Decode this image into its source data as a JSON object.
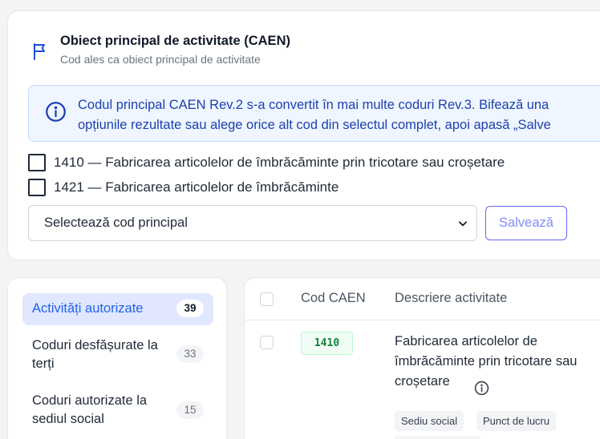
{
  "section": {
    "title": "Obiect principal de activitate (CAEN)",
    "subtitle": "Cod ales ca obiect principal de activitate",
    "icon": "flag-icon"
  },
  "alert": {
    "icon": "info-icon",
    "line1": "Codul principal CAEN Rev.2 s-a convertit în mai multe coduri Rev.3. Bifează una",
    "line2": "opțiunile rezultate sau alege orice alt cod din selectul complet, apoi apasă „Salve"
  },
  "options": [
    {
      "label": "1410 — Fabricarea articolelor de îmbrăcăminte prin tricotare sau croșetare",
      "checked": false
    },
    {
      "label": "1421 — Fabricarea articolelor de îmbrăcăminte",
      "checked": false
    }
  ],
  "select": {
    "value": "Selectează cod principal"
  },
  "save_label": "Salvează",
  "nav": {
    "items": [
      {
        "label": "Activități autorizate",
        "count": "39",
        "active": true
      },
      {
        "label": "Coduri desfășurate la terți",
        "count": "33",
        "active": false
      },
      {
        "label": "Coduri autorizate la sediul social",
        "count": "15",
        "active": false
      }
    ]
  },
  "table": {
    "headers": [
      "Cod CAEN",
      "Descriere activitate"
    ],
    "rows": [
      {
        "code": "1410",
        "description": "Fabricarea articolelor de îmbrăcăminte prin tricotare sau croșetare",
        "tags": [
          "Sediu social",
          "Punct de lucru"
        ]
      }
    ]
  },
  "colors": {
    "accent": "#2563eb",
    "alert_bg": "#eff6ff",
    "code_green": "#15803d",
    "save_border": "#6366f1"
  }
}
